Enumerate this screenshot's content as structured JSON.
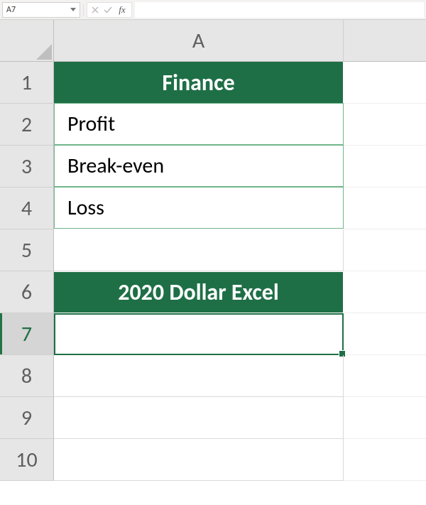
{
  "name_box": {
    "value": "A7"
  },
  "fx_label": "fx",
  "formula_input": {
    "value": ""
  },
  "column_header": "A",
  "rows": {
    "r1": {
      "num": "1",
      "value": "Finance"
    },
    "r2": {
      "num": "2",
      "value": "Profit"
    },
    "r3": {
      "num": "3",
      "value": "Break-even"
    },
    "r4": {
      "num": "4",
      "value": "Loss"
    },
    "r5": {
      "num": "5",
      "value": ""
    },
    "r6": {
      "num": "6",
      "value": "2020 Dollar Excel"
    },
    "r7": {
      "num": "7",
      "value": ""
    },
    "r8": {
      "num": "8",
      "value": ""
    },
    "r9": {
      "num": "9",
      "value": ""
    },
    "r10": {
      "num": "10",
      "value": ""
    }
  },
  "colors": {
    "brand_green": "#1f6f46",
    "cell_border_green": "#6fb58a"
  }
}
